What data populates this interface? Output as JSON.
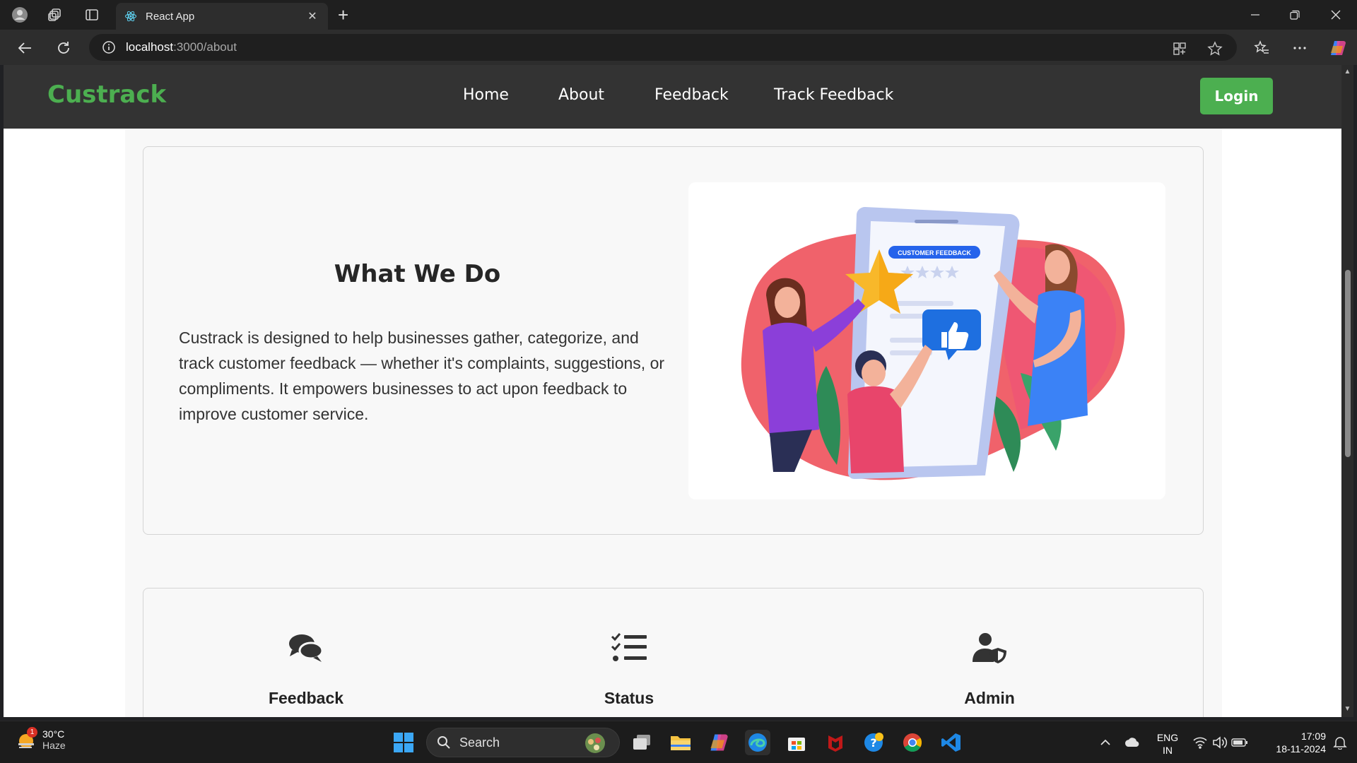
{
  "browser": {
    "tab_title": "React App",
    "url_host": "localhost",
    "url_path": ":3000/about"
  },
  "navbar": {
    "brand": "Custrack",
    "links": [
      "Home",
      "About",
      "Feedback",
      "Track Feedback"
    ],
    "login_label": "Login"
  },
  "about": {
    "title": "What We Do",
    "description": "Custrack is designed to help businesses gather, categorize, and track customer feedback — whether it's complaints, suggestions, or compliments. It empowers businesses to act upon feedback to improve customer service.",
    "illustration_badge": "CUSTOMER FEEDBACK"
  },
  "features": [
    {
      "label": "Feedback",
      "icon": "comments-icon"
    },
    {
      "label": "Status",
      "icon": "tasks-list-icon"
    },
    {
      "label": "Admin",
      "icon": "user-shield-icon"
    }
  ],
  "taskbar": {
    "weather_temp": "30°C",
    "weather_cond": "Haze",
    "weather_badge": "1",
    "search_label": "Search",
    "lang_line1": "ENG",
    "lang_line2": "IN",
    "time": "17:09",
    "date": "18-11-2024"
  },
  "colors": {
    "brand_green": "#4caf50",
    "navbar_bg": "#333333",
    "illustration_red": "#f0626b",
    "illustration_blue": "#3b82f6"
  }
}
